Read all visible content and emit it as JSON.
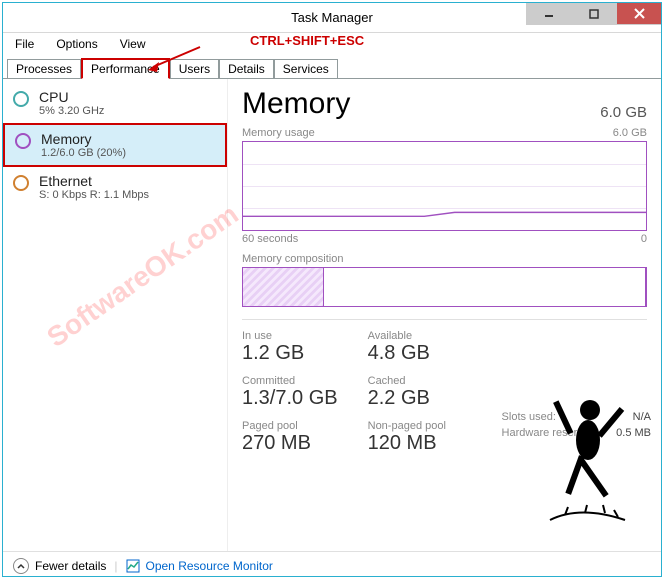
{
  "titlebar": {
    "title": "Task Manager"
  },
  "menu": {
    "file": "File",
    "options": "Options",
    "view": "View"
  },
  "annotation": {
    "shortcut": "CTRL+SHIFT+ESC"
  },
  "tabs": {
    "processes": "Processes",
    "performance": "Performance",
    "users": "Users",
    "details": "Details",
    "services": "Services"
  },
  "sidebar": {
    "cpu": {
      "title": "CPU",
      "sub": "5%  3.20 GHz"
    },
    "memory": {
      "title": "Memory",
      "sub": "1.2/6.0 GB (20%)"
    },
    "ethernet": {
      "title": "Ethernet",
      "sub": "S: 0 Kbps  R: 1.1 Mbps"
    }
  },
  "main": {
    "title": "Memory",
    "capacity": "6.0 GB",
    "usage_label": "Memory usage",
    "usage_max": "6.0 GB",
    "composition_label": "Memory composition",
    "axis_left": "60 seconds",
    "axis_right": "0"
  },
  "stats": {
    "in_use": {
      "label": "In use",
      "val": "1.2 GB"
    },
    "available": {
      "label": "Available",
      "val": "4.8 GB"
    },
    "committed": {
      "label": "Committed",
      "val": "1.3/7.0 GB"
    },
    "cached": {
      "label": "Cached",
      "val": "2.2 GB"
    },
    "paged": {
      "label": "Paged pool",
      "val": "270 MB"
    },
    "nonpaged": {
      "label": "Non-paged pool",
      "val": "120 MB"
    },
    "slots": {
      "label": "Slots used:",
      "val": "N/A"
    },
    "reserved": {
      "label": "Hardware reserved:",
      "val": "0.5 MB"
    }
  },
  "footer": {
    "fewer": "Fewer details",
    "monitor": "Open Resource Monitor"
  },
  "watermark": "SoftwareOK.com",
  "chart_data": {
    "type": "line",
    "title": "Memory usage",
    "xlabel": "60 seconds",
    "ylabel": "",
    "ylim": [
      0,
      6.0
    ],
    "y_unit": "GB",
    "x": [
      60,
      50,
      40,
      30,
      20,
      10,
      0
    ],
    "values": [
      0.9,
      0.9,
      0.9,
      1.2,
      1.2,
      1.2,
      1.2
    ],
    "composition": {
      "in_use_gb": 1.2,
      "total_gb": 6.0
    }
  }
}
